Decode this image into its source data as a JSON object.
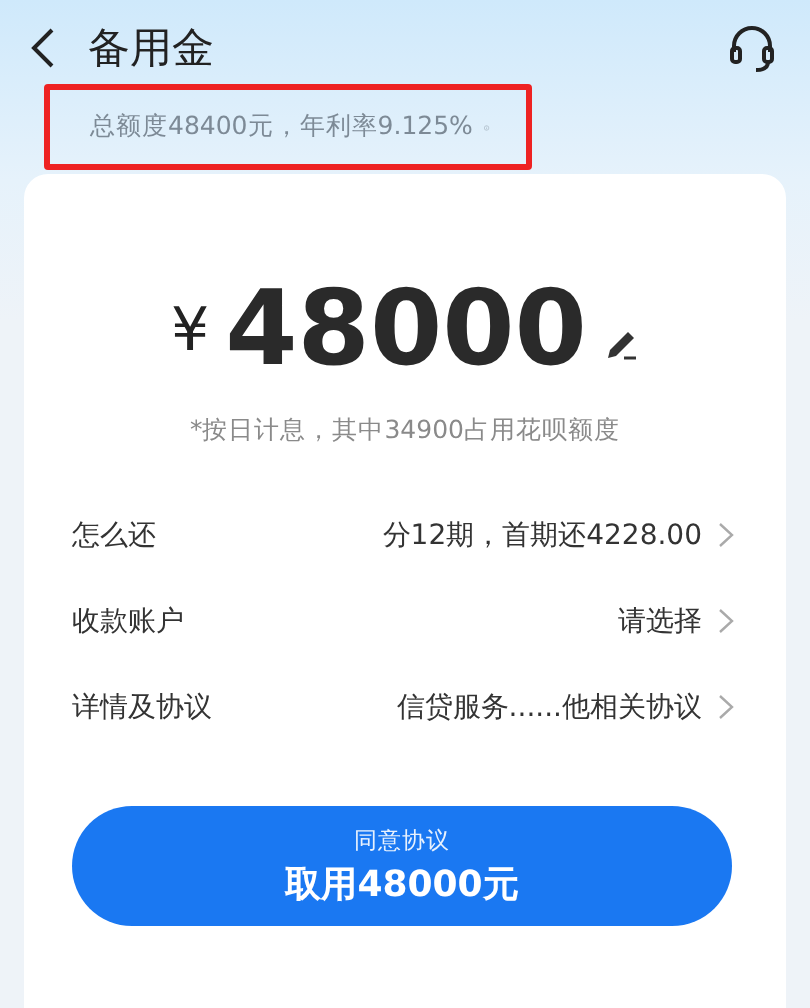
{
  "header": {
    "title": "备用金"
  },
  "summary": {
    "text": "总额度48400元，年利率9.125%",
    "highlighted": true
  },
  "amount": {
    "currency": "¥",
    "value": "48000"
  },
  "note": "*按日计息，其中34900占用花呗额度",
  "rows": [
    {
      "label": "怎么还",
      "value": "分12期，首期还4228.00"
    },
    {
      "label": "收款账户",
      "value": "请选择"
    },
    {
      "label": "详情及协议",
      "value": "信贷服务......他相关协议"
    }
  ],
  "button": {
    "caption": "同意协议",
    "label": "取用48000元"
  }
}
